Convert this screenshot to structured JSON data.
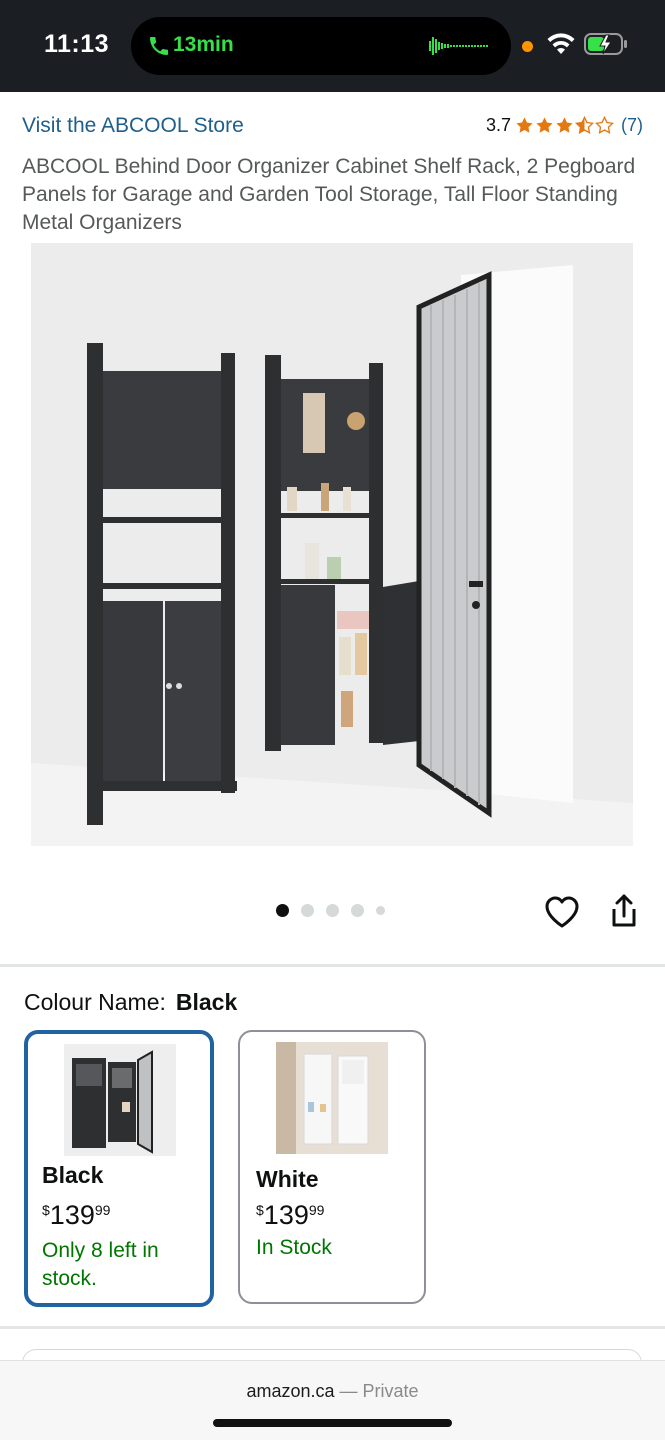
{
  "status_bar": {
    "time": "11:13",
    "call_duration": "13min",
    "call_icon": "phone-icon",
    "accent_green": "#37e048"
  },
  "header": {
    "store_link": "Visit the ABCOOL Store",
    "rating_value": "3.7",
    "rating_stars": 3.7,
    "rating_count": "(7)",
    "star_color": "#e47911"
  },
  "product": {
    "title": "ABCOOL Behind Door Organizer Cabinet Shelf Rack, 2 Pegboard Panels for Garage and Garden Tool Storage, Tall Floor Standing Metal Organizers"
  },
  "gallery": {
    "image_count": 5,
    "active_index": 0,
    "favorite_icon": "heart-icon",
    "share_icon": "share-icon"
  },
  "variations": {
    "label": "Colour Name:",
    "selected_value": "Black",
    "options": [
      {
        "name": "Black",
        "price_currency": "$",
        "price_whole": "139",
        "price_cents": "99",
        "stock": "Only 8 left in stock."
      },
      {
        "name": "White",
        "price_currency": "$",
        "price_whole": "139",
        "price_cents": "99",
        "stock": "In Stock"
      }
    ]
  },
  "browser": {
    "domain": "amazon.ca",
    "separator": " — ",
    "mode": "Private"
  }
}
